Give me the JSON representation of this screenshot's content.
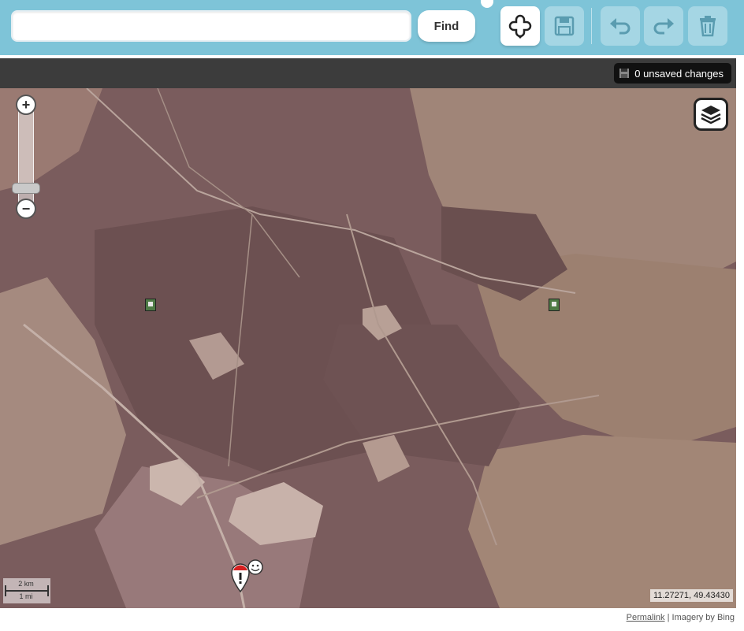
{
  "search": {
    "value": "",
    "placeholder": "",
    "find_label": "Find"
  },
  "toolbar": {
    "add_icon": "add-feature-icon",
    "save_icon": "save-icon",
    "undo_icon": "undo-icon",
    "redo_icon": "redo-icon",
    "delete_icon": "trash-icon"
  },
  "status": {
    "unsaved_text": "0 unsaved changes"
  },
  "map": {
    "zoom_in_label": "+",
    "zoom_out_label": "−",
    "zoom_level": 0.9,
    "layers_icon": "layers-icon",
    "scale_km": "2 km",
    "scale_mi": "1 mi",
    "coordinates": "11.27271, 49.43430"
  },
  "footer": {
    "permalink": "Permalink",
    "separator": "|",
    "imagery": "Imagery by Bing"
  },
  "colors": {
    "toolbar_bg": "#7ec4d8",
    "statusbar_bg": "#3c3c3c",
    "map_bg": "#7c5e5e"
  }
}
